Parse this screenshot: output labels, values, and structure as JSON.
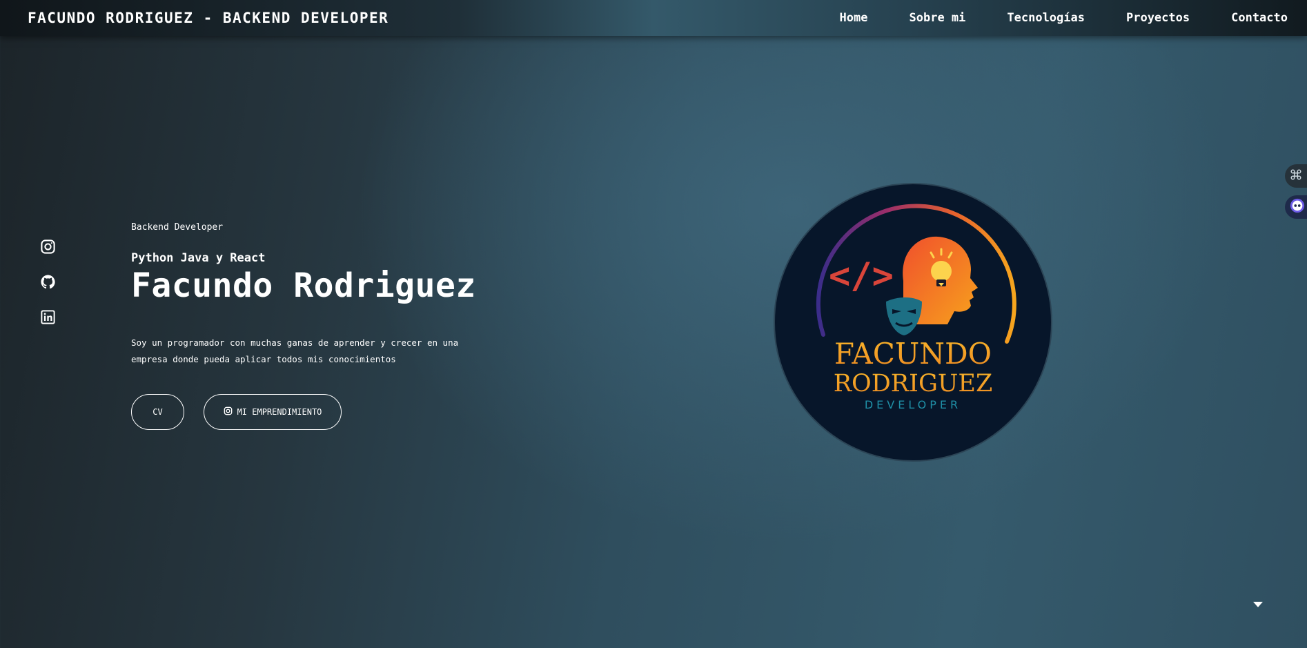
{
  "navbar": {
    "brand": "FACUNDO RODRIGUEZ - BACKEND DEVELOPER",
    "links": [
      "Home",
      "Sobre mi",
      "Tecnologías",
      "Proyectos",
      "Contacto"
    ]
  },
  "socials": [
    "instagram-icon",
    "github-icon",
    "linkedin-icon"
  ],
  "hero": {
    "eyebrow": "Backend Developer",
    "subtitle": "Python Java y React",
    "name": "Facundo Rodriguez",
    "description": "Soy un programador con muchas ganas de aprender y crecer en una empresa donde pueda aplicar todos mis conocimientos",
    "buttons": {
      "cv": "CV",
      "emprendimiento": "MI EMPRENDIMIENTO"
    }
  },
  "logo": {
    "code_symbol": "</>",
    "line1": "FACUNDO",
    "line2": "RODRIGUEZ",
    "line3": "DEVELOPER"
  },
  "colors": {
    "logo_bg": "#07162a",
    "logo_orange": "#f5a424",
    "logo_teal": "#1f8fa6",
    "code_red": "#d9453a"
  },
  "side_widgets": [
    "command-icon",
    "assistant-icon"
  ],
  "scroll_indicator": "chevron-down-icon"
}
